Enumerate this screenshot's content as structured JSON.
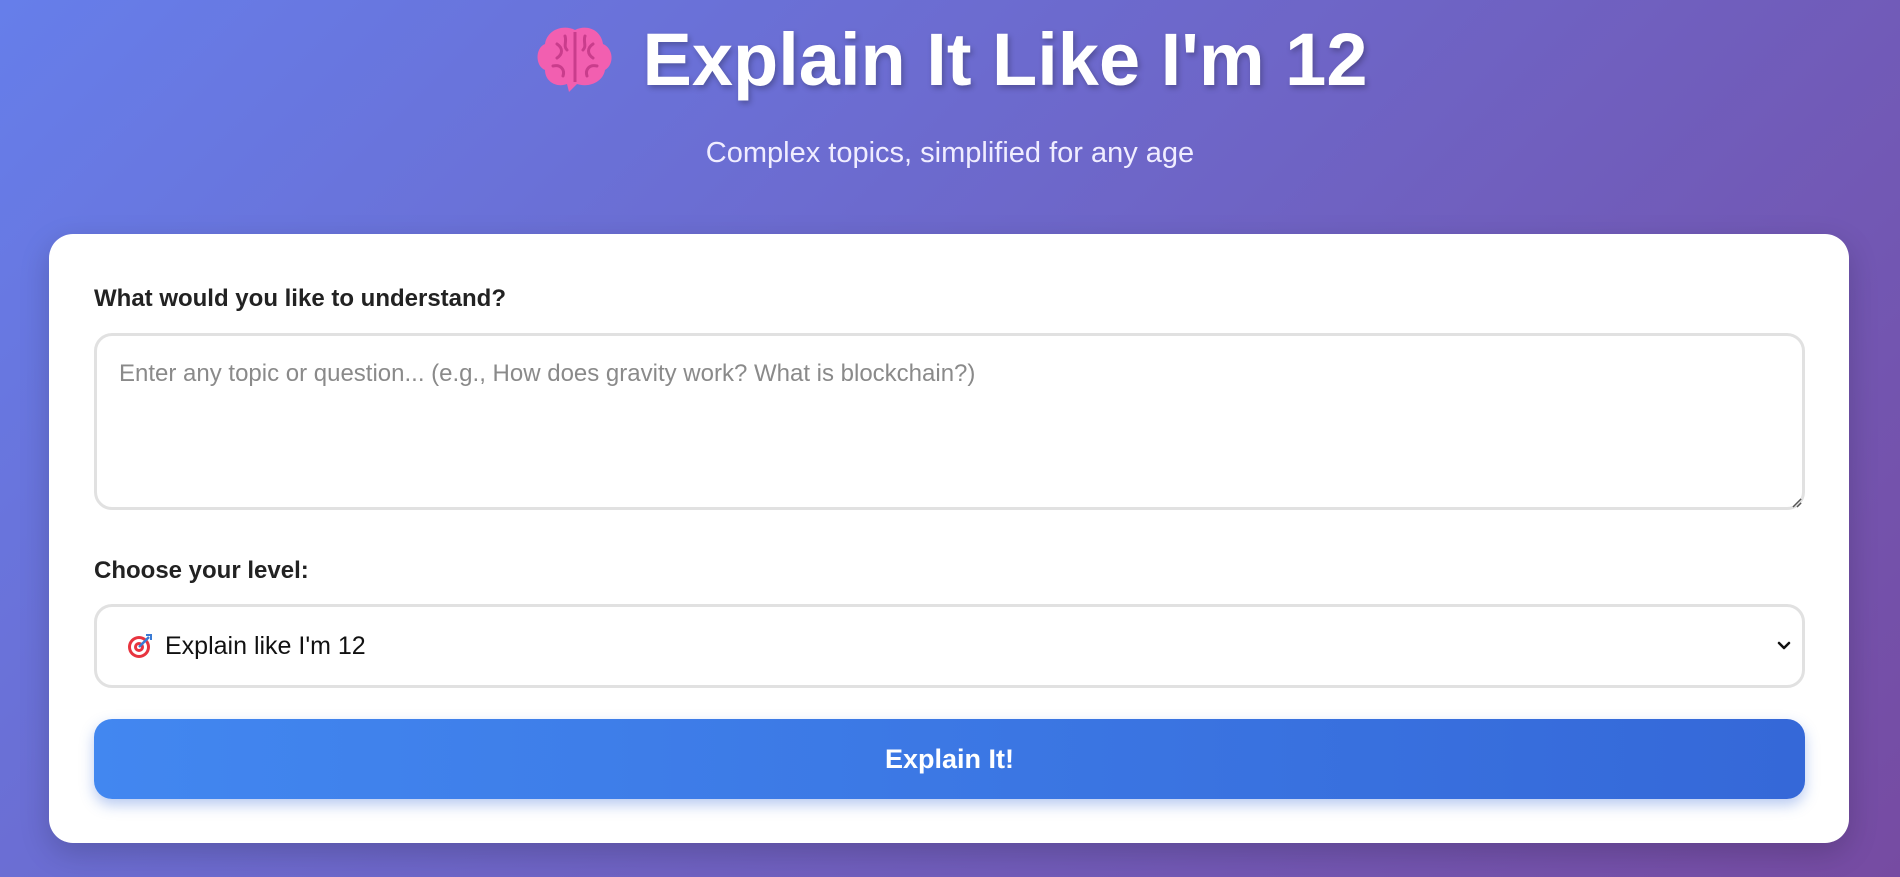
{
  "header": {
    "title": "Explain It Like I'm 12",
    "title_icon": "brain-icon",
    "subtitle": "Complex topics, simplified for any age"
  },
  "form": {
    "topic_label": "What would you like to understand?",
    "topic_placeholder": "Enter any topic or question... (e.g., How does gravity work? What is blockchain?)",
    "topic_value": "",
    "level_label": "Choose your level:",
    "level_selected": "Explain like I'm 12",
    "level_icon": "target-icon",
    "submit_label": "Explain It!"
  },
  "colors": {
    "background_start": "#667eea",
    "background_end": "#764ba2",
    "button_start": "#4287f0",
    "button_end": "#3568d8",
    "card": "#ffffff"
  }
}
